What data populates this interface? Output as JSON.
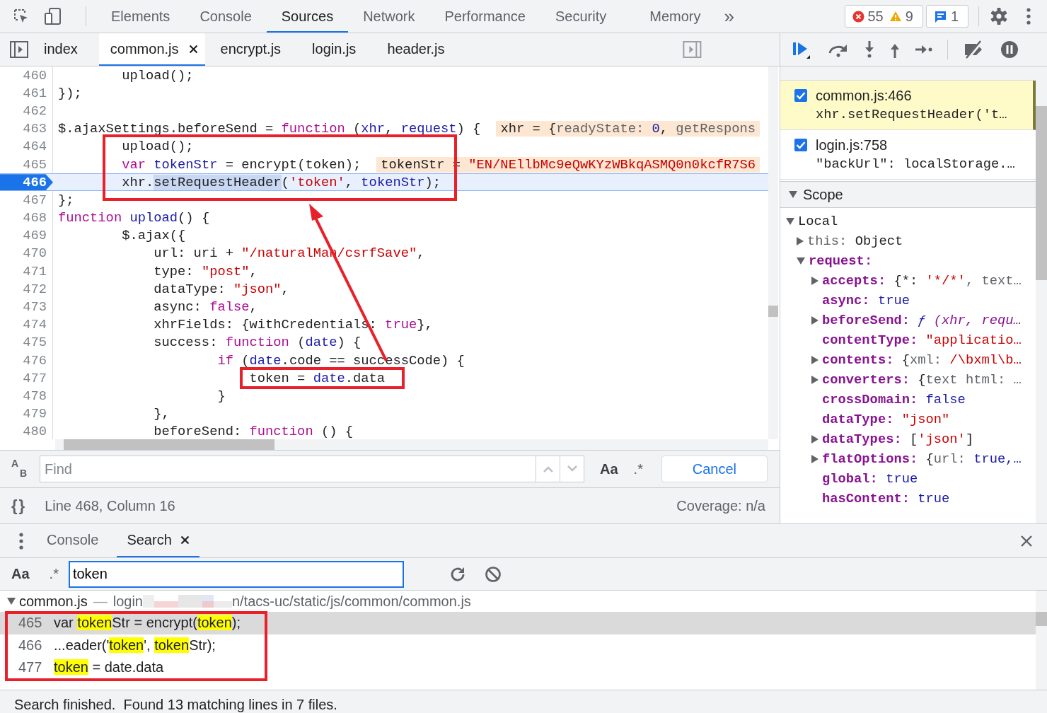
{
  "panel_tabs": [
    {
      "label": "Elements",
      "selected": false
    },
    {
      "label": "Console",
      "selected": false
    },
    {
      "label": "Sources",
      "selected": true
    },
    {
      "label": "Network",
      "selected": false
    },
    {
      "label": "Performance",
      "selected": false
    },
    {
      "label": "Security",
      "selected": false
    },
    {
      "label": "Memory",
      "selected": false
    }
  ],
  "overflow": "»",
  "counters": {
    "errors": "55",
    "warnings": "9",
    "messages": "1"
  },
  "file_tabs": [
    {
      "label": "index",
      "selected": false
    },
    {
      "label": "common.js",
      "selected": true
    },
    {
      "label": "encrypt.js",
      "selected": false
    },
    {
      "label": "login.js",
      "selected": false
    },
    {
      "label": "header.js",
      "selected": false
    }
  ],
  "code_lines": [
    {
      "number": "460",
      "current": false,
      "tokens": [
        {
          "text": "        upload();",
          "kind": "plain"
        }
      ]
    },
    {
      "number": "461",
      "current": false,
      "tokens": [
        {
          "text": "});",
          "kind": "plain"
        }
      ]
    },
    {
      "number": "462",
      "current": false
    },
    {
      "number": "463",
      "current": false,
      "tokens": [
        {
          "text": "$.ajaxSettings.beforeSend = ",
          "kind": "plain"
        },
        {
          "text": "function",
          "kind": "keyword"
        },
        {
          "text": " (",
          "kind": "plain"
        },
        {
          "text": "xhr",
          "kind": "variable"
        },
        {
          "text": ", ",
          "kind": "plain"
        },
        {
          "text": "request",
          "kind": "variable"
        },
        {
          "text": ") {",
          "kind": "plain"
        }
      ],
      "inline_value": [
        {
          "text": "xhr = {",
          "kind": "plain"
        },
        {
          "text": "readyState: ",
          "kind": "muted"
        },
        {
          "text": "0",
          "kind": "number"
        },
        {
          "text": ", ",
          "kind": "plain"
        },
        {
          "text": "getRespons",
          "kind": "muted"
        }
      ]
    },
    {
      "number": "464",
      "current": false,
      "tokens": [
        {
          "text": "        upload();",
          "kind": "plain"
        }
      ]
    },
    {
      "number": "465",
      "current": false,
      "tokens": [
        {
          "text": "        var",
          "kind": "keyword"
        },
        {
          "text": " tokenStr",
          "kind": "variable"
        },
        {
          "text": " = encrypt(token);",
          "kind": "plain"
        }
      ],
      "inline_value": [
        {
          "text": "tokenStr = ",
          "kind": "plain"
        },
        {
          "text": "\"EN/NEllbMc9eQwKYzWBkqASMQ0n0kcfR7S6",
          "kind": "string"
        }
      ]
    },
    {
      "number": "466",
      "current": true,
      "tokens": [
        {
          "text": "        xhr.",
          "kind": "plain"
        },
        {
          "text": "setRequestHeader",
          "kind": "selection"
        },
        {
          "text": "(",
          "kind": "plain"
        },
        {
          "text": "'token'",
          "kind": "string"
        },
        {
          "text": ", ",
          "kind": "plain"
        },
        {
          "text": "tokenStr",
          "kind": "variable"
        },
        {
          "text": ");",
          "kind": "plain"
        }
      ]
    },
    {
      "number": "467",
      "current": false,
      "tokens": [
        {
          "text": "};",
          "kind": "plain"
        }
      ]
    },
    {
      "number": "468",
      "current": false,
      "tokens": [
        {
          "text": "function",
          "kind": "keyword"
        },
        {
          "text": " upload",
          "kind": "variable"
        },
        {
          "text": "() {",
          "kind": "plain"
        }
      ]
    },
    {
      "number": "469",
      "current": false,
      "tokens": [
        {
          "text": "        $.ajax({",
          "kind": "plain"
        }
      ]
    },
    {
      "number": "470",
      "current": false,
      "tokens": [
        {
          "text": "            url: uri + ",
          "kind": "plain"
        },
        {
          "text": "\"/naturalMan/csrfSave\"",
          "kind": "string"
        },
        {
          "text": ",",
          "kind": "plain"
        }
      ]
    },
    {
      "number": "471",
      "current": false,
      "tokens": [
        {
          "text": "            type: ",
          "kind": "plain"
        },
        {
          "text": "\"post\"",
          "kind": "string"
        },
        {
          "text": ",",
          "kind": "plain"
        }
      ]
    },
    {
      "number": "472",
      "current": false,
      "tokens": [
        {
          "text": "            dataType: ",
          "kind": "plain"
        },
        {
          "text": "\"json\"",
          "kind": "string"
        },
        {
          "text": ",",
          "kind": "plain"
        }
      ]
    },
    {
      "number": "473",
      "current": false,
      "tokens": [
        {
          "text": "            async: ",
          "kind": "plain"
        },
        {
          "text": "false",
          "kind": "keyword"
        },
        {
          "text": ",",
          "kind": "plain"
        }
      ]
    },
    {
      "number": "474",
      "current": false,
      "tokens": [
        {
          "text": "            xhrFields: {withCredentials: ",
          "kind": "plain"
        },
        {
          "text": "true",
          "kind": "keyword"
        },
        {
          "text": "},",
          "kind": "plain"
        }
      ]
    },
    {
      "number": "475",
      "current": false,
      "tokens": [
        {
          "text": "            success: ",
          "kind": "plain"
        },
        {
          "text": "function",
          "kind": "keyword"
        },
        {
          "text": " (",
          "kind": "plain"
        },
        {
          "text": "date",
          "kind": "variable"
        },
        {
          "text": ") {",
          "kind": "plain"
        }
      ]
    },
    {
      "number": "476",
      "current": false,
      "tokens": [
        {
          "text": "                    if",
          "kind": "keyword"
        },
        {
          "text": " (",
          "kind": "plain"
        },
        {
          "text": "date",
          "kind": "variable"
        },
        {
          "text": ".code == successCode) {",
          "kind": "plain"
        }
      ]
    },
    {
      "number": "477",
      "current": false,
      "tokens": [
        {
          "text": "                        token = ",
          "kind": "plain"
        },
        {
          "text": "date",
          "kind": "variable"
        },
        {
          "text": ".data",
          "kind": "plain"
        }
      ]
    },
    {
      "number": "478",
      "current": false,
      "tokens": [
        {
          "text": "                    }",
          "kind": "plain"
        }
      ]
    },
    {
      "number": "479",
      "current": false,
      "tokens": [
        {
          "text": "            },",
          "kind": "plain"
        }
      ]
    },
    {
      "number": "480",
      "current": false,
      "tokens": [
        {
          "text": "            beforeSend: ",
          "kind": "plain"
        },
        {
          "text": "function",
          "kind": "keyword"
        },
        {
          "text": " () {",
          "kind": "plain"
        }
      ]
    }
  ],
  "find": {
    "replace_toggle": "AB",
    "placeholder": "Find",
    "case_toggle": "Aa",
    "regex_toggle": ".*",
    "cancel": "Cancel"
  },
  "status": {
    "format_button": "{}",
    "position": "Line 468, Column 16",
    "coverage": "Coverage: n/a"
  },
  "breakpoints": [
    {
      "location": "common.js:466",
      "code": "xhr.setRequestHeader('t…",
      "checked": true,
      "selected": true
    },
    {
      "location": "login.js:758",
      "code": "\"backUrl\": localStorage.…",
      "checked": true,
      "selected": false
    }
  ],
  "scope": {
    "title": "Scope",
    "expanded": true,
    "tree": [
      {
        "name": "Local",
        "kind": "section",
        "expanded": true,
        "children": [
          {
            "name": "this: ",
            "kind": "inherited",
            "expanded": false,
            "value": [
              {
                "text": "Object",
                "kind": "plain"
              }
            ]
          },
          {
            "name": "request:",
            "kind": "own",
            "expanded": true,
            "children": [
              {
                "name": "accepts: ",
                "kind": "own",
                "expanded": false,
                "value": [
                  {
                    "text": "{*: ",
                    "kind": "plain"
                  },
                  {
                    "text": "'*/*'",
                    "kind": "string"
                  },
                  {
                    "text": ", text…",
                    "kind": "muted"
                  }
                ]
              },
              {
                "name": "async: ",
                "kind": "own",
                "value": [
                  {
                    "text": "true",
                    "kind": "atom"
                  }
                ]
              },
              {
                "name": "beforeSend: ",
                "kind": "own",
                "expanded": false,
                "value": [
                  {
                    "text": "ƒ",
                    "kind": "func"
                  },
                  {
                    "text": " (xhr, requ…",
                    "kind": "italic"
                  }
                ]
              },
              {
                "name": "contentType: ",
                "kind": "own",
                "value": [
                  {
                    "text": "\"applicatio…",
                    "kind": "string"
                  }
                ]
              },
              {
                "name": "contents: ",
                "kind": "own",
                "expanded": false,
                "value": [
                  {
                    "text": "{",
                    "kind": "plain"
                  },
                  {
                    "text": "xml: ",
                    "kind": "muted"
                  },
                  {
                    "text": "/\\bxml\\b…",
                    "kind": "string"
                  }
                ]
              },
              {
                "name": "converters: ",
                "kind": "own",
                "expanded": false,
                "value": [
                  {
                    "text": "{",
                    "kind": "plain"
                  },
                  {
                    "text": "text html: …",
                    "kind": "muted"
                  }
                ]
              },
              {
                "name": "crossDomain: ",
                "kind": "own",
                "value": [
                  {
                    "text": "false",
                    "kind": "atom"
                  }
                ]
              },
              {
                "name": "dataType: ",
                "kind": "own",
                "value": [
                  {
                    "text": "\"json\"",
                    "kind": "string"
                  }
                ]
              },
              {
                "name": "dataTypes: ",
                "kind": "own",
                "expanded": false,
                "value": [
                  {
                    "text": "[",
                    "kind": "plain"
                  },
                  {
                    "text": "'json'",
                    "kind": "string"
                  },
                  {
                    "text": "]",
                    "kind": "plain"
                  }
                ]
              },
              {
                "name": "flatOptions: ",
                "kind": "own",
                "expanded": false,
                "value": [
                  {
                    "text": "{",
                    "kind": "plain"
                  },
                  {
                    "text": "url: ",
                    "kind": "muted"
                  },
                  {
                    "text": "true,…",
                    "kind": "atom"
                  }
                ]
              },
              {
                "name": "global: ",
                "kind": "own",
                "value": [
                  {
                    "text": "true",
                    "kind": "atom"
                  }
                ]
              },
              {
                "name": "hasContent: ",
                "kind": "own",
                "value": [
                  {
                    "text": "true",
                    "kind": "atom"
                  }
                ]
              }
            ]
          }
        ]
      }
    ]
  },
  "drawer_tabs": [
    {
      "label": "Console",
      "selected": false
    },
    {
      "label": "Search",
      "selected": true
    }
  ],
  "search": {
    "case_toggle": "Aa",
    "regex_toggle": ".*",
    "value": "token"
  },
  "results": {
    "file": "common.js",
    "separator": "—",
    "path_start": "login",
    "path_end": "n/tacs-uc/static/js/common/common.js",
    "expanded": true,
    "matches": [
      {
        "line": "465",
        "selected": true,
        "segments": [
          {
            "text": "var ",
            "match": false
          },
          {
            "text": "token",
            "match": true
          },
          {
            "text": "Str = encrypt(",
            "match": false
          },
          {
            "text": "token",
            "match": true
          },
          {
            "text": ");",
            "match": false
          }
        ]
      },
      {
        "line": "466",
        "selected": false,
        "segments": [
          {
            "text": "...eader('",
            "match": false
          },
          {
            "text": "token",
            "match": true
          },
          {
            "text": "', ",
            "match": false
          },
          {
            "text": "token",
            "match": true
          },
          {
            "text": "Str);",
            "match": false
          }
        ]
      },
      {
        "line": "477",
        "selected": false,
        "segments": [
          {
            "text": "token",
            "match": true
          },
          {
            "text": " = date.data",
            "match": false
          }
        ]
      }
    ]
  },
  "search_status": "Search finished.  Found 13 matching lines in 7 files."
}
